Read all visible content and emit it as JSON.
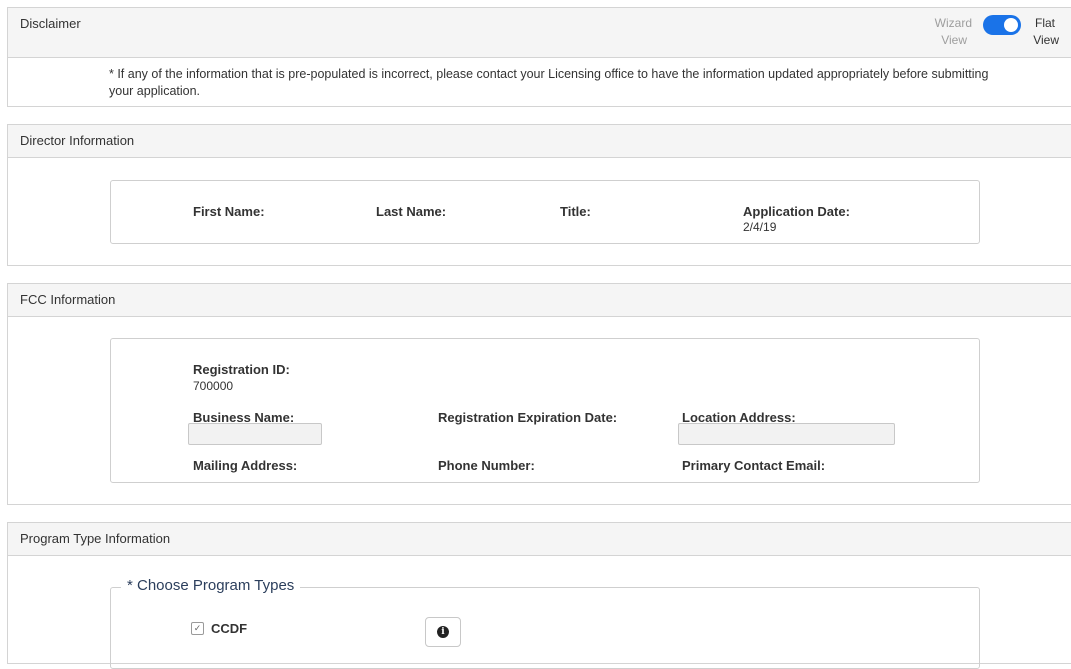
{
  "disclaimer": {
    "title": "Disclaimer",
    "text": "* If any of the information that is pre-populated is incorrect, please contact your Licensing office to have the information updated appropriately before submitting your application.",
    "view_toggle": {
      "wizard_label_1": "Wizard",
      "wizard_label_2": "View",
      "flat_label_1": "Flat",
      "flat_label_2": "View",
      "state": "Flat View",
      "accent_color": "#1a73e8"
    }
  },
  "director": {
    "title": "Director Information",
    "first_name_label": "First Name:",
    "last_name_label": "Last Name:",
    "title_label": "Title:",
    "application_date_label": "Application Date:",
    "application_date_value": "2/4/19"
  },
  "fcc": {
    "title": "FCC Information",
    "registration_id_label": "Registration ID:",
    "registration_id_value": "700000",
    "business_name_label": "Business Name:",
    "registration_expiration_label": "Registration Expiration Date:",
    "location_address_label": "Location Address:",
    "mailing_address_label": "Mailing Address:",
    "phone_number_label": "Phone Number:",
    "primary_contact_email_label": "Primary Contact Email:"
  },
  "program": {
    "title": "Program Type Information",
    "legend": "* Choose Program Types",
    "options": [
      {
        "label": "CCDF",
        "checked": true
      }
    ],
    "info_icon": "info-circle-icon"
  }
}
